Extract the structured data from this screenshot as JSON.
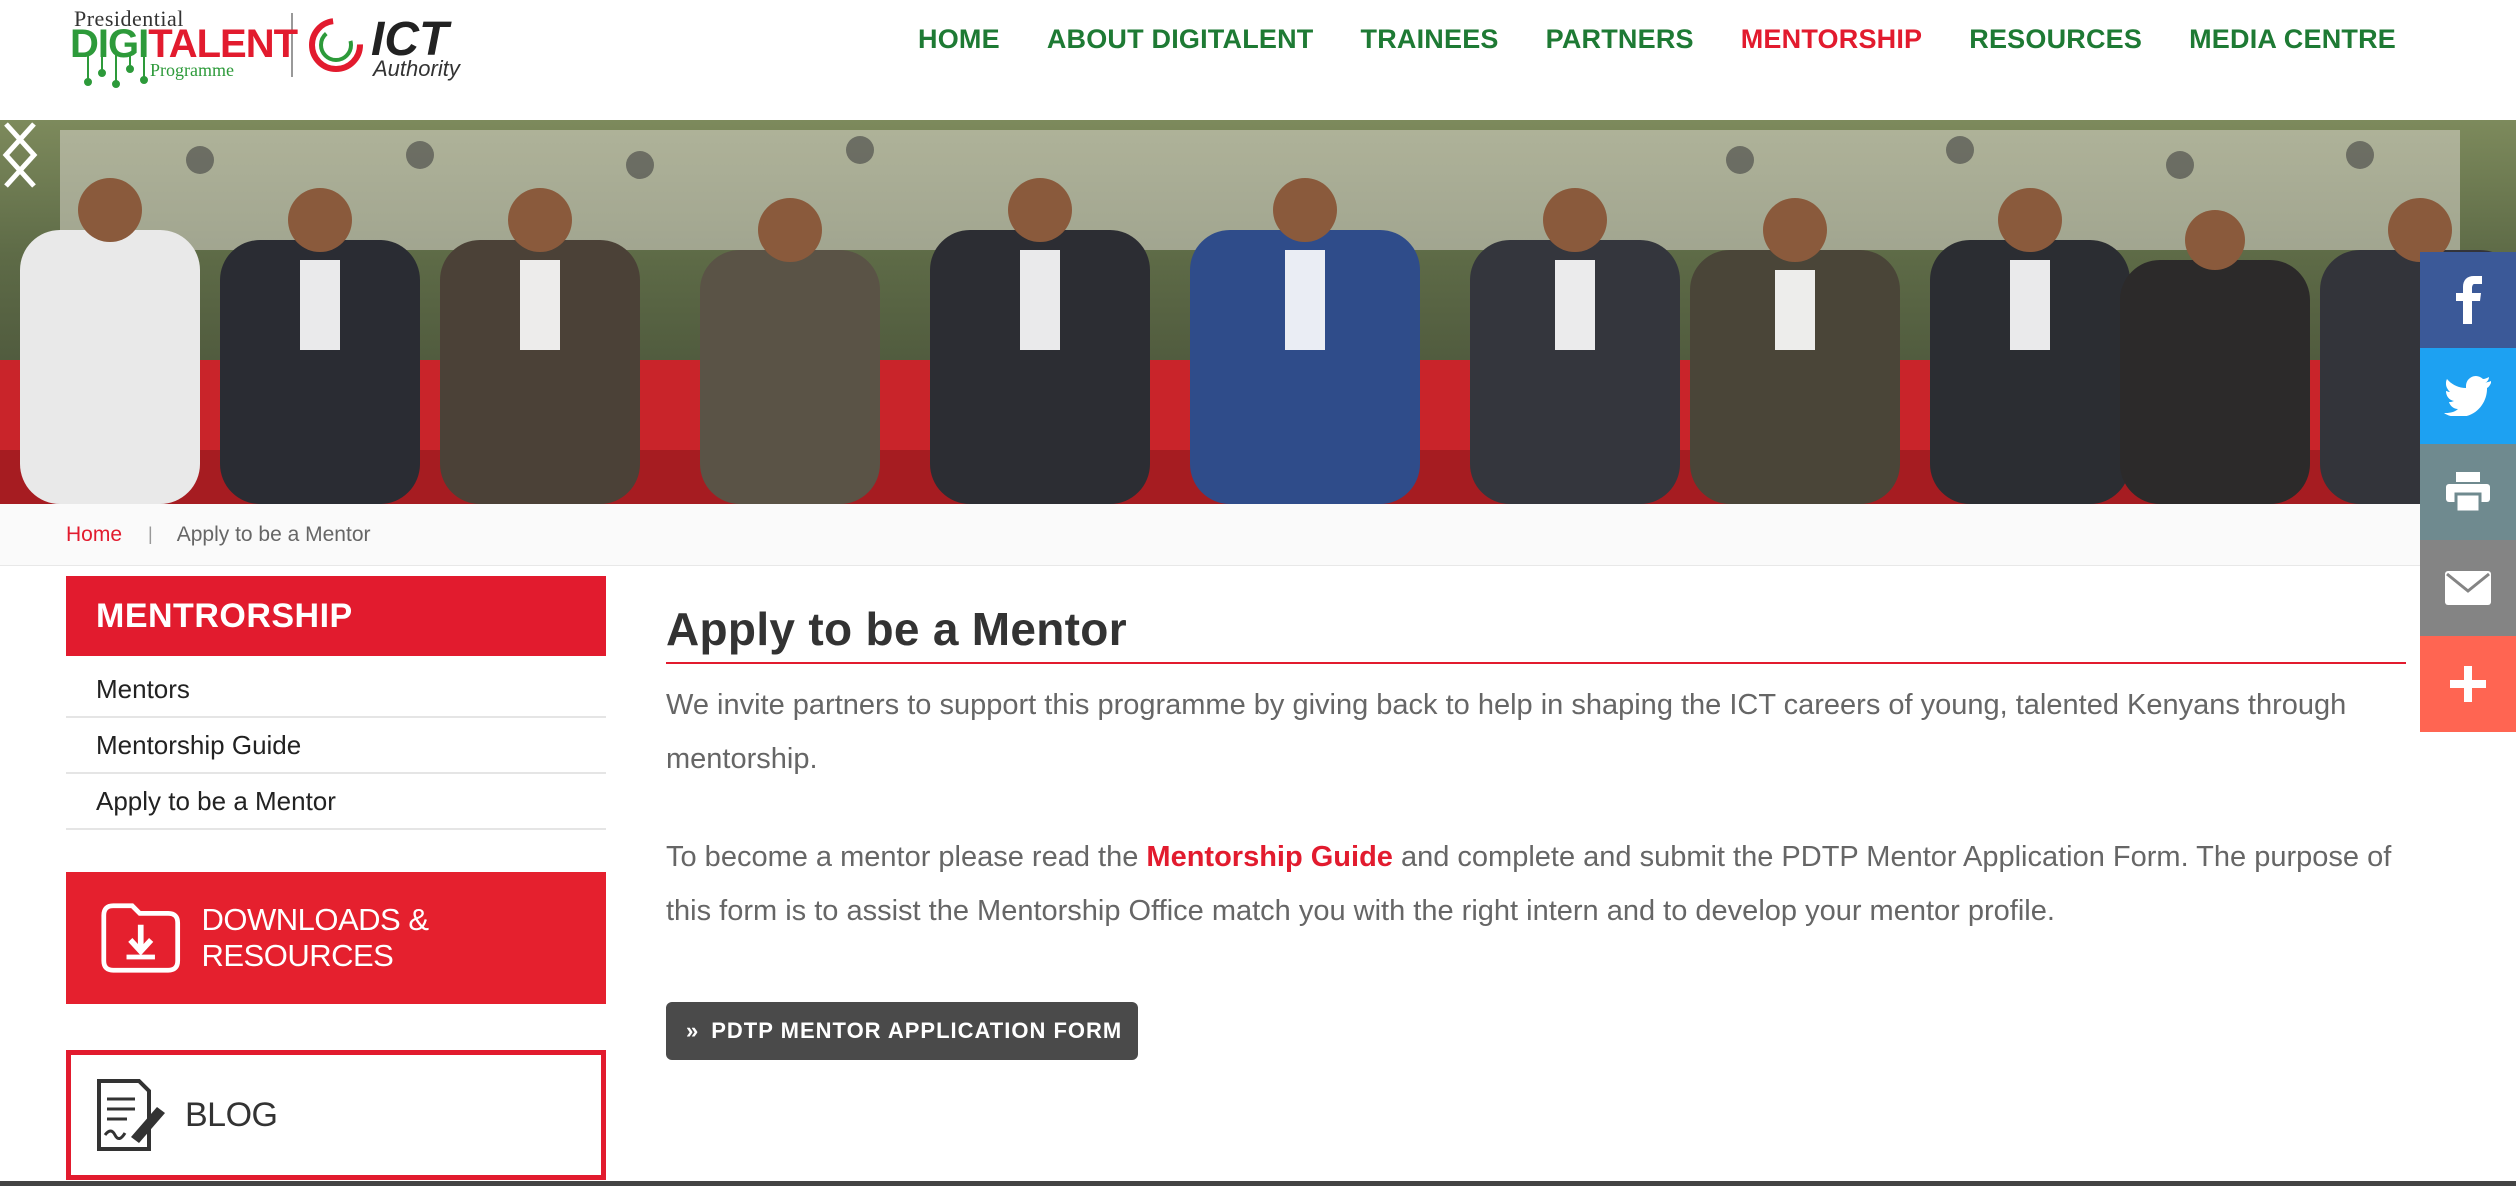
{
  "header": {
    "logo_pdtp": {
      "line1": "Presidential",
      "line2_green": "DIGI",
      "line2_red": "TALENT",
      "line3": "Programme"
    },
    "logo_ict": {
      "title": "ICT",
      "subtitle": "Authority"
    },
    "nav": [
      {
        "label": "HOME",
        "active": false
      },
      {
        "label": "ABOUT DIGITALENT",
        "active": false
      },
      {
        "label": "TRAINEES",
        "active": false
      },
      {
        "label": "PARTNERS",
        "active": false
      },
      {
        "label": "MENTORSHIP",
        "active": true
      },
      {
        "label": "RESOURCES",
        "active": false
      },
      {
        "label": "MEDIA CENTRE",
        "active": false
      }
    ]
  },
  "banner": {
    "prev_icon": "chevron-left-icon",
    "next_icon": "chevron-right-icon"
  },
  "social": [
    "facebook-icon",
    "twitter-icon",
    "print-icon",
    "email-icon",
    "plus-icon"
  ],
  "breadcrumb": {
    "home": "Home",
    "separator": "|",
    "current": "Apply to be a Mentor"
  },
  "sidebar": {
    "title": "MENTRORSHIP",
    "items": [
      {
        "label": "Mentors"
      },
      {
        "label": "Mentorship Guide"
      },
      {
        "label": "Apply to be a Mentor"
      }
    ],
    "downloads_label": "DOWNLOADS & RESOURCES",
    "blog_label": "BLOG"
  },
  "main": {
    "title": "Apply to be a Mentor",
    "para1": "We invite partners to support this programme by giving back to help in shaping the ICT careers of young, talented Kenyans through mentorship.",
    "para2_before": "To become a mentor please read the ",
    "para2_link": "Mentorship Guide",
    "para2_after": " and complete and submit the PDTP Mentor Application Form. The purpose of this form is to assist the Mentorship Office match you with the right intern and to develop your mentor profile.",
    "cta_label": "PDTP MENTOR APPLICATION FORM"
  },
  "colors": {
    "brand_red": "#e21b2e",
    "nav_green": "#1e7a34",
    "facebook": "#3b5998",
    "twitter": "#1da1f2",
    "print": "#6f8a8f",
    "email": "#848484",
    "plus": "#ff6552"
  }
}
